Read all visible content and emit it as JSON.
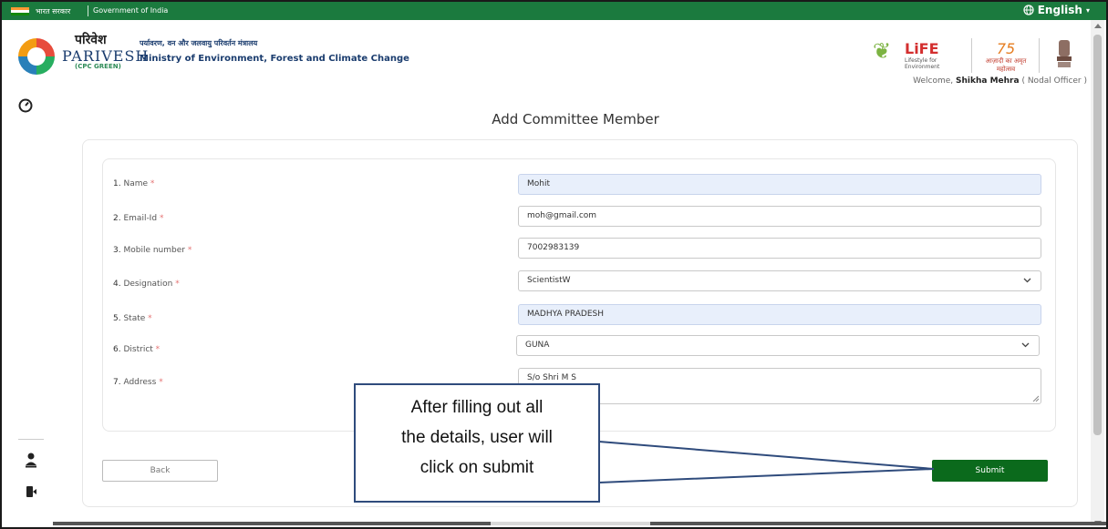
{
  "gov_bar": {
    "hindi": "भारत सरकार",
    "goi": "Government of India",
    "language": "English"
  },
  "header": {
    "brand_hindi": "परिवेश",
    "brand": "PARIVESH",
    "brand_sub": "(CPC GREEN)",
    "ministry_hindi": "पर्यावरण, वन और जलवायु परिवर्तन मंत्रालय",
    "ministry": "Ministry of Environment, Forest and Climate Change",
    "life": "LiFE",
    "life_sub": "Lifestyle for Environment",
    "azadi_num": "75",
    "azadi_text": "आज़ादी का अमृत महोत्सव",
    "welcome_prefix": "Welcome,",
    "user_name": "Shikha Mehra",
    "user_role": "( Nodal Officer )"
  },
  "page": {
    "title": "Add Committee Member"
  },
  "form": {
    "rows": [
      {
        "num": "1.",
        "label": "Name",
        "req": "*",
        "value": "Mohit"
      },
      {
        "num": "2.",
        "label": "Email-Id",
        "req": "*",
        "value": "moh@gmail.com"
      },
      {
        "num": "3.",
        "label": "Mobile number",
        "req": "*",
        "value": "7002983139"
      },
      {
        "num": "4.",
        "label": "Designation",
        "req": "*",
        "value": "ScientistW"
      },
      {
        "num": "5.",
        "label": "State",
        "req": "*",
        "value": "MADHYA PRADESH"
      },
      {
        "num": "6.",
        "label": "District",
        "req": "*",
        "value": "GUNA"
      },
      {
        "num": "7.",
        "label": "Address",
        "req": "*",
        "value": "S/o Shri M S"
      }
    ],
    "back_label": "Back",
    "submit_label": "Submit"
  },
  "callout": {
    "line1": "After filling out all",
    "line2": "the details, user will",
    "line3": "click on submit"
  },
  "colors": {
    "gov_bar": "#1b7a3e",
    "submit": "#0b6a1c",
    "filled_field": "#e8effb",
    "callout_border": "#2f4b7c"
  },
  "icons": [
    "globe-icon",
    "dashboard-icon",
    "user-icon",
    "logout-icon",
    "chevron-down-icon"
  ]
}
